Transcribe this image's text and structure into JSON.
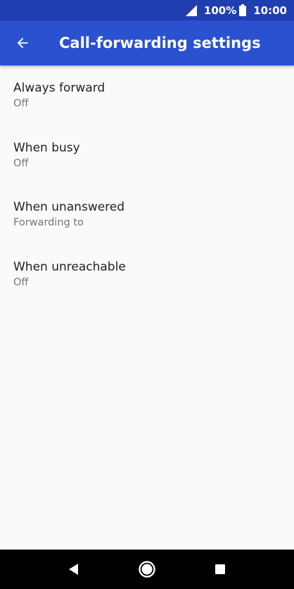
{
  "status_bar": {
    "battery": "100%",
    "time": "10:00",
    "background": "#203eb0"
  },
  "app_bar": {
    "title": "Call-forwarding settings",
    "background": "#2a52d0",
    "back_icon": "arrow-left-icon"
  },
  "items": [
    {
      "title": "Always forward",
      "subtitle": "Off"
    },
    {
      "title": "When busy",
      "subtitle": "Off"
    },
    {
      "title": "When unanswered",
      "subtitle": "Forwarding to"
    },
    {
      "title": "When unreachable",
      "subtitle": "Off"
    }
  ],
  "nav_bar": {
    "back_icon": "triangle-back-icon",
    "home_icon": "circle-home-icon",
    "recent_icon": "square-recents-icon"
  }
}
